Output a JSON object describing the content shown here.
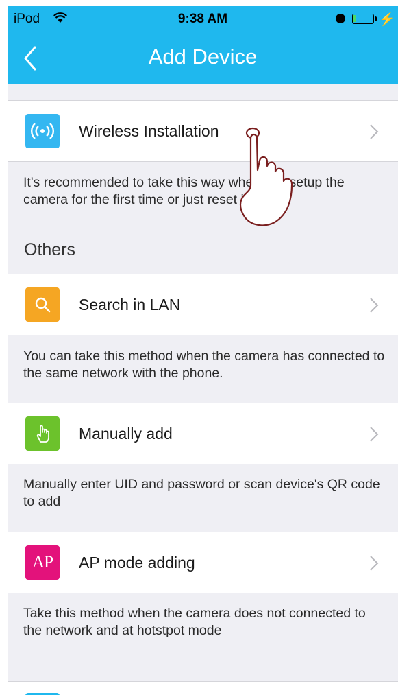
{
  "status_bar": {
    "carrier": "iPod",
    "time": "9:38 AM"
  },
  "header": {
    "title": "Add Device"
  },
  "items": [
    {
      "label": "Wireless Installation",
      "description": "It's recommended to take this way when you setup the camera for the first time or just reset it.",
      "icon": "wireless-signal-icon",
      "color": "#34b7f1"
    },
    {
      "label": "Search in LAN",
      "description": "You can take this method when the camera has connected to the same network with the phone.",
      "icon": "search-icon",
      "color": "#f5a623"
    },
    {
      "label": "Manually add",
      "description": "Manually enter UID and password or scan device's QR code to add",
      "icon": "hand-pointer-icon",
      "color": "#6cc22c"
    },
    {
      "label": "AP mode adding",
      "description": "Take this method when the camera does not connected to the network and at hotstpot mode",
      "icon": "ap-icon",
      "icon_text": "AP",
      "color": "#e3127b"
    }
  ],
  "section": {
    "others": "Others"
  },
  "colors": {
    "accent": "#1fb8ee",
    "background": "#efeff4"
  }
}
